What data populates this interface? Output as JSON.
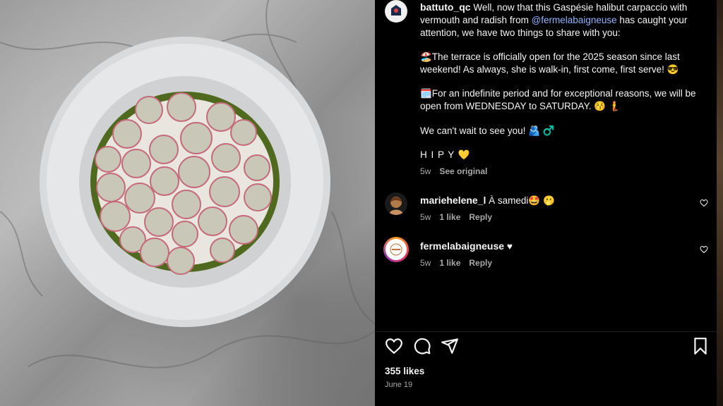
{
  "post": {
    "caption_user": "battuto_qc",
    "caption_lead": "Well, now that this Gaspésie halibut carpaccio with vermouth and radish from ",
    "caption_mention": "@fermelabaigneuse",
    "caption_tail": " has caught your attention, we have two things to share with you:",
    "para1": "🏖️The terrace is officially open for the 2025 season since last weekend! As always, she is walk-in, first come, first serve! 😎",
    "para2": "🗓️For an indefinite period and for exceptional reasons, we will be open from WEDNESDAY to SATURDAY. 😚 🧜",
    "para3": "We can't wait to see you! 🫂  ♂️",
    "sign": "H I P Y 💛",
    "age": "5w",
    "see_original": "See original"
  },
  "comments": [
    {
      "user": "mariehelene_l",
      "text": "À samedi🤩 🫢",
      "age": "5w",
      "likes": "1 like",
      "reply": "Reply"
    },
    {
      "user": "fermelabaigneuse",
      "text": "♥",
      "age": "5w",
      "likes": "1 like",
      "reply": "Reply"
    }
  ],
  "footer": {
    "likes": "355 likes",
    "date": "June 19"
  },
  "icons": [
    "like-icon",
    "comment-icon",
    "share-icon",
    "save-icon",
    "comment-like-icon"
  ]
}
